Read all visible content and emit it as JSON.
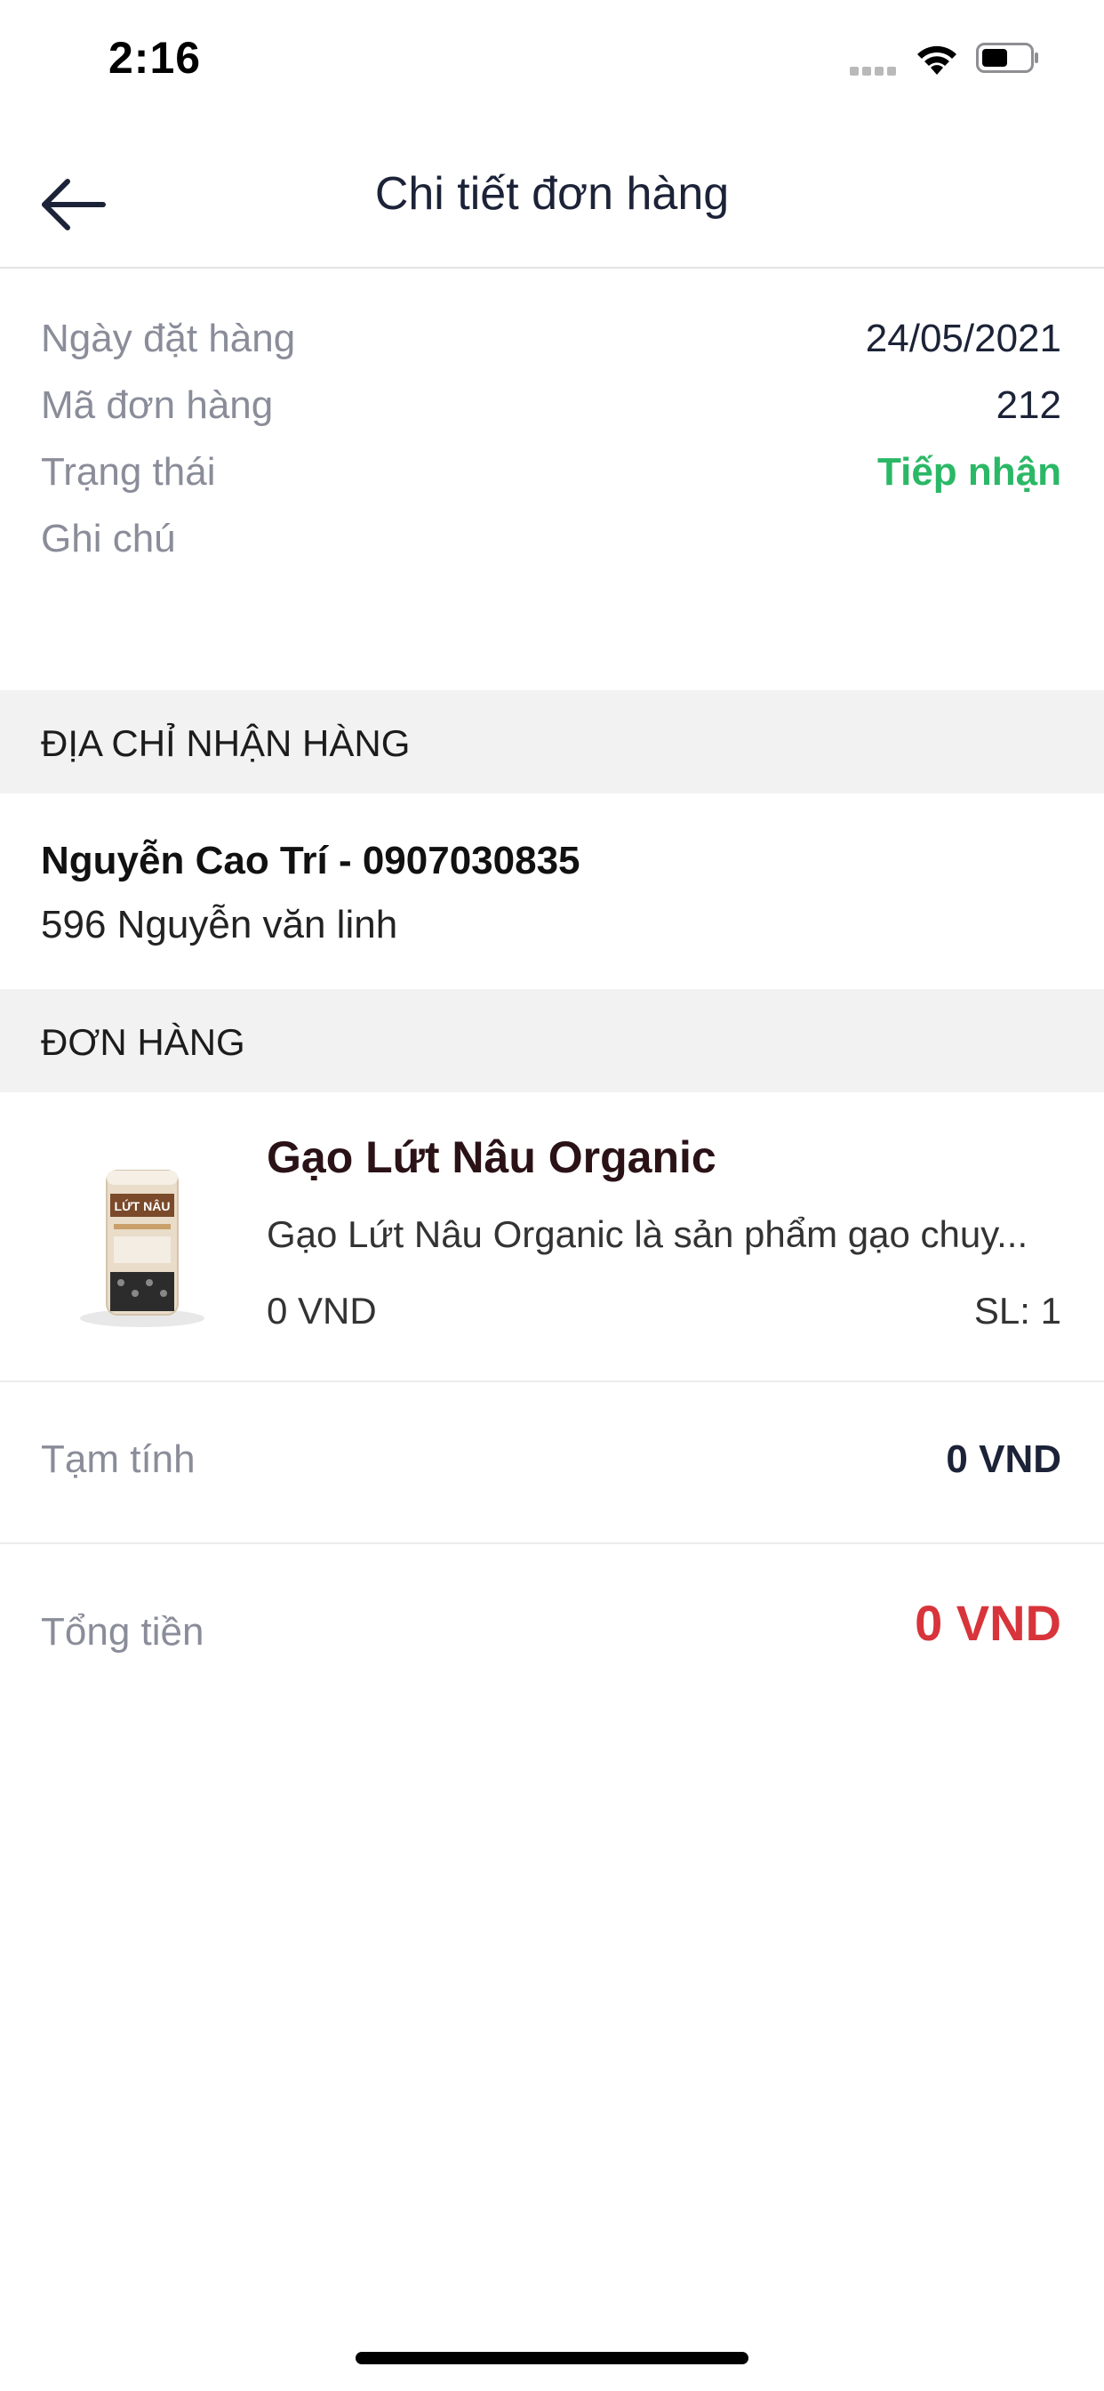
{
  "status_bar": {
    "time": "2:16"
  },
  "header": {
    "title": "Chi tiết đơn hàng",
    "back_icon": "arrow-left-icon"
  },
  "order_info": [
    {
      "label": "Ngày đặt hàng",
      "value": "24/05/2021"
    },
    {
      "label": "Mã đơn hàng",
      "value": "212"
    },
    {
      "label": "Trạng thái",
      "value": "Tiếp nhận"
    },
    {
      "label": "Ghi chú",
      "value": ""
    }
  ],
  "status_color": "#2bb866",
  "address_section": {
    "header": "ĐỊA CHỈ NHẬN HÀNG",
    "recipient": "Nguyễn Cao Trí - 0907030835",
    "address": "596 Nguyễn văn linh"
  },
  "order_section": {
    "header": "ĐƠN HÀNG",
    "product": {
      "name": "Gạo Lứt Nâu Organic",
      "description": "Gạo Lứt Nâu Organic là sản phẩm gạo chuy...",
      "price": "0 VND",
      "quantity": "SL: 1",
      "image_label": "LỨT NÂU"
    }
  },
  "totals": {
    "subtotal_label": "Tạm tính",
    "subtotal_value": "0 VND",
    "total_label": "Tổng tiền",
    "total_value": "0 VND",
    "total_color": "#d8343b"
  }
}
